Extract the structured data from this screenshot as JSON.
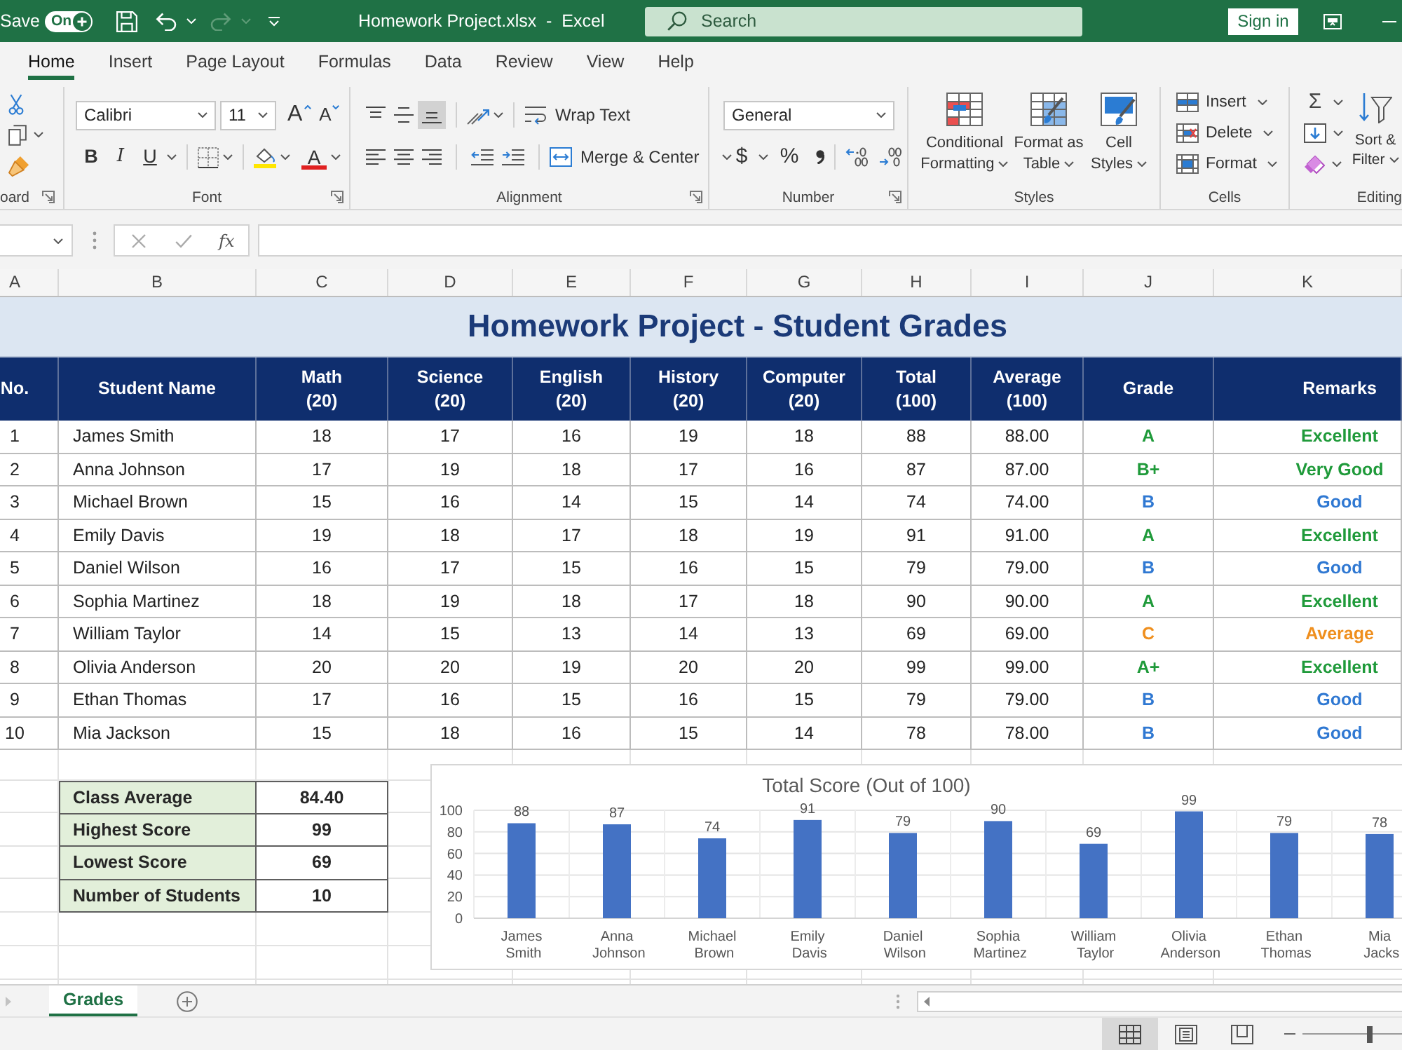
{
  "title_bar": {
    "autosave_label": "Save",
    "autosave": {
      "label": "On",
      "on": true
    },
    "undo": {
      "disabled": false
    },
    "redo": {
      "disabled": true
    },
    "document_title": "Homework Project.xlsx  -  Excel",
    "search": {
      "placeholder": "Search"
    },
    "sign_in": "Sign in"
  },
  "ribbon_tabs": [
    {
      "label": "Home",
      "selected": true
    },
    {
      "label": "Insert",
      "selected": false
    },
    {
      "label": "Page Layout",
      "selected": false
    },
    {
      "label": "Formulas",
      "selected": false
    },
    {
      "label": "Data",
      "selected": false
    },
    {
      "label": "Review",
      "selected": false
    },
    {
      "label": "View",
      "selected": false
    },
    {
      "label": "Help",
      "selected": false
    }
  ],
  "ribbon": {
    "clipboard": {
      "label": "oard"
    },
    "font": {
      "label": "Font",
      "name": "Calibri",
      "size": "11",
      "size_buttons": [
        {
          "kind": "grow",
          "text": "A"
        },
        {
          "kind": "shrink",
          "text": "A"
        }
      ],
      "style_buttons": [
        {
          "kind": "bold",
          "text": "B"
        },
        {
          "kind": "italic",
          "text": "I"
        },
        {
          "kind": "underline",
          "text": "U"
        }
      ],
      "font_color": {
        "text": "A"
      }
    },
    "alignment": {
      "label": "Alignment",
      "vertical": [
        {
          "kind": "top",
          "selected": false
        },
        {
          "kind": "middle",
          "selected": false
        },
        {
          "kind": "bottom",
          "selected": true
        }
      ],
      "wrap_text": "Wrap Text",
      "merge": "Merge & Center"
    },
    "number": {
      "label": "Number",
      "format": "General",
      "currency": "$",
      "percent": "%"
    },
    "styles": {
      "label": "Styles",
      "buttons": [
        {
          "kind": "conditional",
          "text": "Conditional Formatting"
        },
        {
          "kind": "table",
          "text": "Format as Table"
        },
        {
          "kind": "cell",
          "text": "Cell Styles"
        }
      ]
    },
    "cells": {
      "label": "Cells",
      "buttons": [
        {
          "kind": "insert",
          "text": "Insert"
        },
        {
          "kind": "delete",
          "text": "Delete"
        },
        {
          "kind": "format",
          "text": "Format"
        }
      ]
    },
    "editing": {
      "label": "Editing",
      "autosum": "Σ",
      "sort_filter": "Sort & Filter"
    }
  },
  "formula_bar": {
    "function_label": "fx"
  },
  "column_headers": [
    "A",
    "B",
    "C",
    "D",
    "E",
    "F",
    "G",
    "H",
    "I",
    "J",
    "K"
  ],
  "sheet": {
    "title": "Homework Project - Student Grades",
    "columns": [
      {
        "label": "No."
      },
      {
        "label": "Student Name"
      },
      {
        "label": "Math",
        "sublabel": "(20)"
      },
      {
        "label": "Science",
        "sublabel": "(20)"
      },
      {
        "label": "English",
        "sublabel": "(20)"
      },
      {
        "label": "History",
        "sublabel": "(20)"
      },
      {
        "label": "Computer",
        "sublabel": "(20)"
      },
      {
        "label": "Total",
        "sublabel": "(100)"
      },
      {
        "label": "Average",
        "sublabel": "(100)"
      },
      {
        "label": "Grade"
      },
      {
        "label": "Remarks"
      }
    ],
    "rows": [
      {
        "cells": [
          "1",
          "James Smith",
          "18",
          "17",
          "16",
          "19",
          "18",
          "88",
          "88.00",
          "A",
          "Excellent"
        ],
        "color": "#1f9a3a"
      },
      {
        "cells": [
          "2",
          "Anna Johnson",
          "17",
          "19",
          "18",
          "17",
          "16",
          "87",
          "87.00",
          "B+",
          "Very Good"
        ],
        "color": "#1f9a3a"
      },
      {
        "cells": [
          "3",
          "Michael Brown",
          "15",
          "16",
          "14",
          "15",
          "14",
          "74",
          "74.00",
          "B",
          "Good"
        ],
        "color": "#2f78d2"
      },
      {
        "cells": [
          "4",
          "Emily Davis",
          "19",
          "18",
          "17",
          "18",
          "19",
          "91",
          "91.00",
          "A",
          "Excellent"
        ],
        "color": "#1f9a3a"
      },
      {
        "cells": [
          "5",
          "Daniel Wilson",
          "16",
          "17",
          "15",
          "16",
          "15",
          "79",
          "79.00",
          "B",
          "Good"
        ],
        "color": "#2f78d2"
      },
      {
        "cells": [
          "6",
          "Sophia Martinez",
          "18",
          "19",
          "18",
          "17",
          "18",
          "90",
          "90.00",
          "A",
          "Excellent"
        ],
        "color": "#1f9a3a"
      },
      {
        "cells": [
          "7",
          "William Taylor",
          "14",
          "15",
          "13",
          "14",
          "13",
          "69",
          "69.00",
          "C",
          "Average"
        ],
        "color": "#ef8f1e"
      },
      {
        "cells": [
          "8",
          "Olivia Anderson",
          "20",
          "20",
          "19",
          "20",
          "20",
          "99",
          "99.00",
          "A+",
          "Excellent"
        ],
        "color": "#1f9a3a"
      },
      {
        "cells": [
          "9",
          "Ethan Thomas",
          "17",
          "16",
          "15",
          "16",
          "15",
          "79",
          "79.00",
          "B",
          "Good"
        ],
        "color": "#2f78d2"
      },
      {
        "cells": [
          "10",
          "Mia Jackson",
          "15",
          "18",
          "16",
          "15",
          "14",
          "78",
          "78.00",
          "B",
          "Good"
        ],
        "color": "#2f78d2"
      }
    ]
  },
  "summary": [
    {
      "label": "Class Average",
      "value": "84.40"
    },
    {
      "label": "Highest Score",
      "value": "99"
    },
    {
      "label": "Lowest Score",
      "value": "69"
    },
    {
      "label": "Number of Students",
      "value": "10"
    }
  ],
  "chart": {
    "chart_data": {
      "type": "bar",
      "title": "Total Score (Out of 100)",
      "categories": [
        "James Smith",
        "Anna Johnson",
        "Michael Brown",
        "Emily Davis",
        "Daniel Wilson",
        "Sophia Martinez",
        "William Taylor",
        "Olivia Anderson",
        "Ethan Thomas",
        "Mia Jacks"
      ],
      "values": [
        88,
        87,
        74,
        91,
        79,
        90,
        69,
        99,
        79,
        78
      ],
      "color": "#4472c4",
      "ylim": [
        0,
        100
      ],
      "yticks": [
        0,
        20,
        40,
        60,
        80,
        100
      ],
      "data_labels": true,
      "grid": true
    }
  },
  "sheet_tabs": [
    {
      "label": "Grades",
      "selected": true
    }
  ],
  "status_bar": {
    "views": [
      {
        "kind": "normal",
        "selected": true
      },
      {
        "kind": "page_layout",
        "selected": false
      },
      {
        "kind": "page_break",
        "selected": false
      }
    ],
    "zoom": {
      "level": 0.68
    }
  }
}
